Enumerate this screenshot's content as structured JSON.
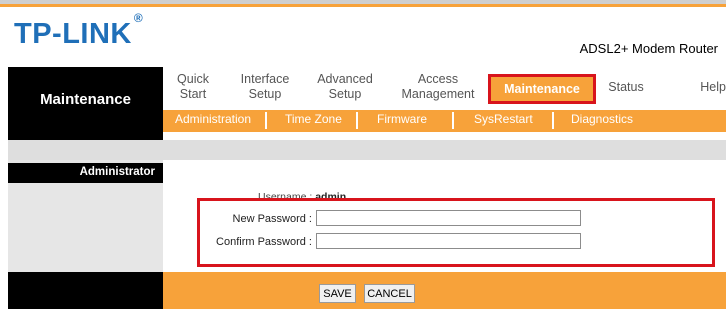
{
  "brand": {
    "logo": "TP-LINK",
    "registered": "®",
    "product": "ADSL2+ Modem Router"
  },
  "section_title": "Maintenance",
  "nav": {
    "items": [
      {
        "line1": "Quick",
        "line2": "Start"
      },
      {
        "line1": "Interface",
        "line2": "Setup"
      },
      {
        "line1": "Advanced",
        "line2": "Setup"
      },
      {
        "line1": "Access",
        "line2": "Management"
      },
      {
        "line1": "Maintenance",
        "line2": ""
      },
      {
        "line1": "Status",
        "line2": ""
      },
      {
        "line1": "Help",
        "line2": ""
      }
    ],
    "active": "Maintenance"
  },
  "subnav": [
    "Administration",
    "Time Zone",
    "Firmware",
    "SysRestart",
    "Diagnostics"
  ],
  "panel": {
    "title": "Administrator"
  },
  "form": {
    "username_label": "Username :",
    "username_value": "admin",
    "new_password_label": "New Password :",
    "confirm_password_label": "Confirm Password :",
    "new_password_value": "",
    "confirm_password_value": ""
  },
  "buttons": {
    "save": "SAVE",
    "cancel": "CANCEL"
  },
  "colors": {
    "accent": "#f7a23a",
    "brand": "#1f6fb8",
    "highlight": "#d8141c"
  }
}
